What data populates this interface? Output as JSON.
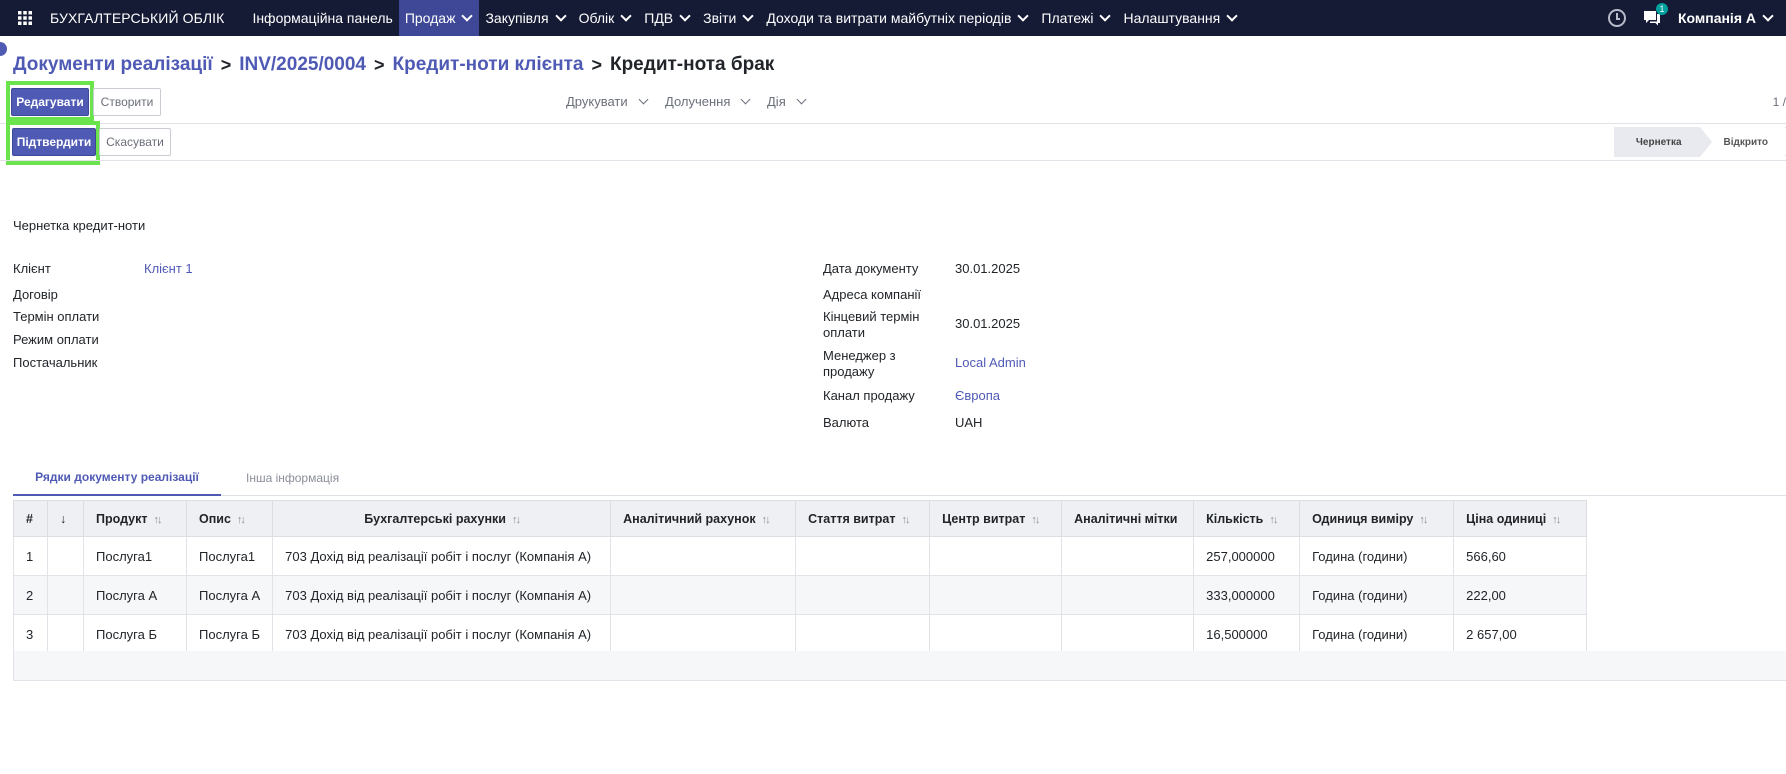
{
  "navbar": {
    "brand": "БУХГАЛТЕРСЬКИЙ ОБЛІК",
    "menu": [
      {
        "label": "Інформаційна панель",
        "caret": false,
        "active": false
      },
      {
        "label": "Продаж",
        "caret": true,
        "active": true
      },
      {
        "label": "Закупівля",
        "caret": true,
        "active": false
      },
      {
        "label": "Облік",
        "caret": true,
        "active": false
      },
      {
        "label": "ПДВ",
        "caret": true,
        "active": false
      },
      {
        "label": "Звіти",
        "caret": true,
        "active": false
      },
      {
        "label": "Доходи та витрати майбутніх періодів",
        "caret": true,
        "active": false
      },
      {
        "label": "Платежі",
        "caret": true,
        "active": false
      },
      {
        "label": "Налаштування",
        "caret": true,
        "active": false
      }
    ],
    "messages_badge": "1",
    "company": "Компанія А",
    "colors": {
      "bar": "#151a35",
      "active": "#3f4896"
    }
  },
  "breadcrumb": {
    "items": [
      "Документи реалізації",
      "INV/2025/0004",
      "Кредит-ноти клієнта"
    ],
    "current": "Кредит-нота брак",
    "separator": ">"
  },
  "controls": {
    "edit_label": "Редагувати",
    "create_label": "Створити",
    "print_label": "Друкувати",
    "attach_label": "Долучення",
    "action_label": "Дія",
    "pager": "1 /"
  },
  "statusbar": {
    "confirm_label": "Підтвердити",
    "cancel_label": "Скасувати",
    "stages": [
      "Чернетка",
      "Відкрито"
    ],
    "current_stage": "Чернетка"
  },
  "form": {
    "title": "Чернетка кредит-ноти",
    "left_fields": [
      {
        "label": "Клієнт",
        "value": "Клієнт 1"
      },
      {
        "label": "Договір",
        "value": ""
      },
      {
        "label": "Термін оплати",
        "value": ""
      },
      {
        "label": "Режим оплати",
        "value": ""
      },
      {
        "label": "Постачальник",
        "value": ""
      }
    ],
    "right_fields": [
      {
        "label": "Дата документу",
        "value": "30.01.2025"
      },
      {
        "label": "Адреса компанії",
        "value": ""
      },
      {
        "label": "Кінцевий термін оплати",
        "value": "30.01.2025"
      },
      {
        "label": "Менеджер з продажу",
        "value": "Local Admin"
      },
      {
        "label": "Канал продажу",
        "value": "Європа"
      },
      {
        "label": "Валюта",
        "value": "UAH"
      }
    ]
  },
  "tabs": [
    {
      "label": "Рядки документу реалізації",
      "active": true
    },
    {
      "label": "Інша інформація",
      "active": false
    }
  ],
  "table": {
    "columns": [
      "#",
      "↓",
      "Продукт",
      "Опис",
      "Бухгалтерські рахунки",
      "Аналітичний рахунок",
      "Стаття витрат",
      "Центр витрат",
      "Аналітичні мітки",
      "Кількість",
      "Одиниця виміру",
      "Ціна одиниці"
    ],
    "rows": [
      [
        "1",
        "",
        "Послуга1",
        "Послуга1",
        "703 Дохід від реалізації робіт і послуг (Компанія А)",
        "",
        "",
        "",
        "",
        "257,000000",
        "Година (години)",
        "566,60"
      ],
      [
        "2",
        "",
        "Послуга А",
        "Послуга А",
        "703 Дохід від реалізації робіт і послуг (Компанія А)",
        "",
        "",
        "",
        "",
        "333,000000",
        "Година (години)",
        "222,00"
      ],
      [
        "3",
        "",
        "Послуга Б",
        "Послуга Б",
        "703 Дохід від реалізації робіт і послуг (Компанія А)",
        "",
        "",
        "",
        "",
        "16,500000",
        "Година (години)",
        "2 657,00"
      ]
    ]
  },
  "accent_color": "#4f5ab5",
  "highlight_color": "#6be34c"
}
